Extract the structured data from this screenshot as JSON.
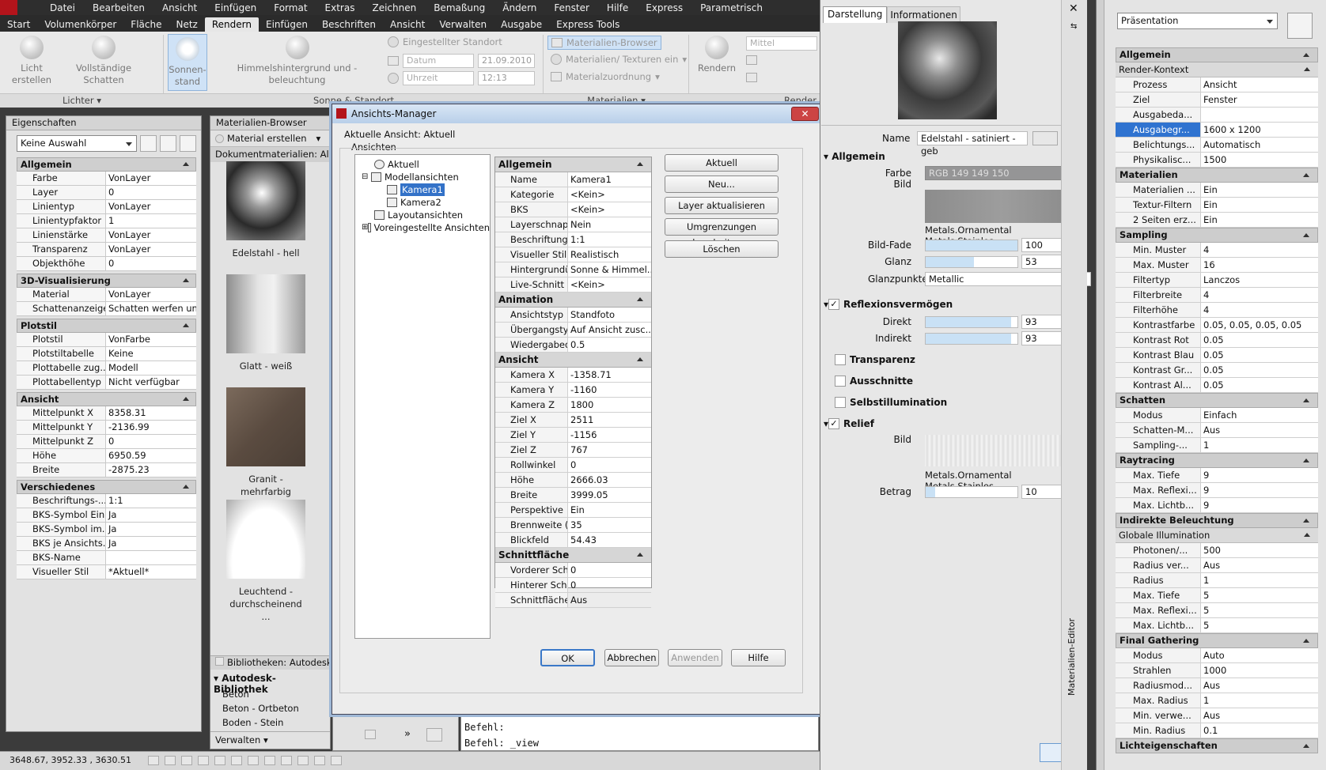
{
  "menubar": {
    "items": [
      "Datei",
      "Bearbeiten",
      "Ansicht",
      "Einfügen",
      "Format",
      "Extras",
      "Zeichnen",
      "Bemaßung",
      "Ändern",
      "Fenster",
      "Hilfe",
      "Express",
      "Parametrisch"
    ]
  },
  "ribbon_tabs": {
    "items": [
      "Start",
      "Volumenkörper",
      "Fläche",
      "Netz",
      "Rendern",
      "Einfügen",
      "Beschriften",
      "Ansicht",
      "Verwalten",
      "Ausgabe",
      "Express Tools"
    ],
    "active": "Rendern"
  },
  "ribbon": {
    "licht_erstellen": "Licht erstellen",
    "schatten": "Vollständige Schatten",
    "sonnenstand": "Sonnen-stand",
    "himmel": "Himmelshintergrund und -beleuchtung",
    "standort": "Eingestellter Standort",
    "datum_label": "Datum",
    "datum_value": "21.09.2010",
    "uhrzeit_label": "Uhrzeit",
    "uhrzeit_value": "12:13",
    "mat_browser": "Materialien-Browser",
    "mat_texturen": "Materialien/ Texturen ein",
    "mat_zuordnung": "Materialzuordnung",
    "rendern": "Rendern",
    "qualitaet": "Mittel",
    "group_lichter": "Lichter",
    "group_sonne": "Sonne & Standort",
    "group_materialien": "Materialien",
    "group_render": "Render"
  },
  "properties": {
    "title": "Eigenschaften",
    "selection": "Keine Auswahl",
    "categories": [
      {
        "name": "Allgemein",
        "rows": [
          [
            "Farbe",
            "VonLayer"
          ],
          [
            "Layer",
            "0"
          ],
          [
            "Linientyp",
            "VonLayer"
          ],
          [
            "Linientypfaktor",
            "1"
          ],
          [
            "Linienstärke",
            "VonLayer"
          ],
          [
            "Transparenz",
            "VonLayer"
          ],
          [
            "Objekthöhe",
            "0"
          ]
        ]
      },
      {
        "name": "3D-Visualisierung",
        "rows": [
          [
            "Material",
            "VonLayer"
          ],
          [
            "Schattenanzeige",
            "Schatten werfen un..."
          ]
        ]
      },
      {
        "name": "Plotstil",
        "rows": [
          [
            "Plotstil",
            "VonFarbe"
          ],
          [
            "Plotstiltabelle",
            "Keine"
          ],
          [
            "Plottabelle zug...",
            "Modell"
          ],
          [
            "Plottabellentyp",
            "Nicht verfügbar"
          ]
        ]
      },
      {
        "name": "Ansicht",
        "rows": [
          [
            "Mittelpunkt X",
            "8358.31"
          ],
          [
            "Mittelpunkt Y",
            "-2136.99"
          ],
          [
            "Mittelpunkt Z",
            "0"
          ],
          [
            "Höhe",
            "6950.59"
          ],
          [
            "Breite",
            "-2875.23"
          ]
        ]
      },
      {
        "name": "Verschiedenes",
        "rows": [
          [
            "Beschriftungs-...",
            "1:1"
          ],
          [
            "BKS-Symbol Ein",
            "Ja"
          ],
          [
            "BKS-Symbol im...",
            "Ja"
          ],
          [
            "BKS je Ansichts...",
            "Ja"
          ],
          [
            "BKS-Name",
            ""
          ],
          [
            "Visueller Stil",
            "*Aktuell*"
          ]
        ]
      }
    ]
  },
  "materials": {
    "title": "Materialien-Browser",
    "create": "Material erstellen",
    "doc_label": "Dokumentmaterialien: Alle",
    "items": [
      "Edelstahl - hell",
      "Glatt - weiß",
      "Granit - mehrfarbig",
      "Leuchtend - durchscheinend ..."
    ],
    "library_header": "Bibliotheken: Autodesk-",
    "library_name": "Autodesk-Bibliothek",
    "library_items": [
      "Beton",
      "Beton - Ortbeton",
      "Boden - Stein"
    ],
    "manage": "Verwalten"
  },
  "command": {
    "line1": "Befehl:",
    "line2": "Befehl: _view"
  },
  "status": {
    "coords": "3648.67, 3952.33 , 3630.51"
  },
  "dialog": {
    "title": "Ansichts-Manager",
    "current": "Aktuelle Ansicht: Aktuell",
    "views_label": "Ansichten",
    "tree": [
      "Aktuell",
      "Modellansichten",
      "Kamera1",
      "Kamera2",
      "Layoutansichten",
      "Voreingestellte Ansichten"
    ],
    "groups": [
      {
        "name": "Allgemein",
        "rows": [
          [
            "Name",
            "Kamera1"
          ],
          [
            "Kategorie",
            "<Kein>"
          ],
          [
            "BKS",
            "<Kein>"
          ],
          [
            "Layerschnapps...",
            "Nein"
          ],
          [
            "Beschriftungs-...",
            "1:1"
          ],
          [
            "Visueller Stil",
            "Realistisch"
          ],
          [
            "Hintergrundü...",
            "Sonne & Himmel..."
          ],
          [
            "Live-Schnitt",
            "<Kein>"
          ]
        ]
      },
      {
        "name": "Animation",
        "rows": [
          [
            "Ansichtstyp",
            "Standfoto"
          ],
          [
            "Übergangstyp",
            "Auf Ansicht zusc..."
          ],
          [
            "Wiedergabeda...",
            "0.5"
          ]
        ]
      },
      {
        "name": "Ansicht",
        "rows": [
          [
            "Kamera X",
            "-1358.71"
          ],
          [
            "Kamera Y",
            "-1160"
          ],
          [
            "Kamera Z",
            "1800"
          ],
          [
            "Ziel X",
            "2511"
          ],
          [
            "Ziel Y",
            "-1156"
          ],
          [
            "Ziel Z",
            "767"
          ],
          [
            "Rollwinkel",
            "0"
          ],
          [
            "Höhe",
            "2666.03"
          ],
          [
            "Breite",
            "3999.05"
          ],
          [
            "Perspektive",
            "Ein"
          ],
          [
            "Brennweite (m...",
            "35"
          ],
          [
            "Blickfeld",
            "54.43"
          ]
        ]
      },
      {
        "name": "Schnittfläche",
        "rows": [
          [
            "Vorderer Schnitt",
            "0"
          ],
          [
            "Hinterer Schnitt",
            "0"
          ],
          [
            "Schnittfläche",
            "Aus"
          ]
        ]
      }
    ],
    "buttons": [
      "Aktuell",
      "Neu...",
      "Layer aktualisieren",
      "Umgrenzungen bearbeiten...",
      "Löschen"
    ],
    "ok": "OK",
    "cancel": "Abbrechen",
    "apply": "Anwenden",
    "help": "Hilfe"
  },
  "editor": {
    "tab1": "Darstellung",
    "tab2": "Informationen",
    "name_label": "Name",
    "name_value": "Edelstahl - satiniert - geb",
    "allgemein": "Allgemein",
    "farbe_label": "Farbe",
    "farbe_value": "RGB 149 149 150",
    "bild_label": "Bild",
    "bild_path": "Metals.Ornamental Metals.Stainles...",
    "bildfade_label": "Bild-Fade",
    "bildfade_value": "100",
    "glanz_label": "Glanz",
    "glanz_value": "53",
    "glanzpunkte_label": "Glanzpunkte",
    "glanzpunkte_value": "Metallic",
    "reflexion": "Reflexionsvermögen",
    "direkt_label": "Direkt",
    "direkt_value": "93",
    "indirekt_label": "Indirekt",
    "indirekt_value": "93",
    "transparenz": "Transparenz",
    "ausschnitte": "Ausschnitte",
    "selbst": "Selbstillumination",
    "relief": "Relief",
    "relief_bild_label": "Bild",
    "relief_path": "Metals.Ornamental Metals.Stainles...",
    "betrag_label": "Betrag",
    "betrag_value": "10",
    "side_label": "Materialien-Editor"
  },
  "render": {
    "preset": "Präsentation",
    "sections": [
      {
        "name": "Allgemein",
        "sub": "Render-Kontext",
        "rows": [
          [
            "Prozess",
            "Ansicht"
          ],
          [
            "Ziel",
            "Fenster"
          ],
          [
            "Ausgabeda...",
            ""
          ],
          [
            "Ausgabegr...",
            "1600 x 1200"
          ],
          [
            "Belichtungs...",
            "Automatisch"
          ],
          [
            "Physikalisc...",
            "1500"
          ]
        ]
      },
      {
        "name": "Materialien",
        "rows": [
          [
            "Materialien ...",
            "Ein"
          ],
          [
            "Textur-Filtern",
            "Ein"
          ],
          [
            "2 Seiten erz...",
            "Ein"
          ]
        ]
      },
      {
        "name": "Sampling",
        "rows": [
          [
            "Min. Muster",
            "4"
          ],
          [
            "Max. Muster",
            "16"
          ],
          [
            "Filtertyp",
            "Lanczos"
          ],
          [
            "Filterbreite",
            "4"
          ],
          [
            "Filterhöhe",
            "4"
          ],
          [
            "Kontrastfarbe",
            "0.05, 0.05, 0.05, 0.05"
          ],
          [
            "Kontrast Rot",
            "0.05"
          ],
          [
            "Kontrast Blau",
            "0.05"
          ],
          [
            "Kontrast Gr...",
            "0.05"
          ],
          [
            "Kontrast Al...",
            "0.05"
          ]
        ]
      },
      {
        "name": "Schatten",
        "rows": [
          [
            "Modus",
            "Einfach"
          ],
          [
            "Schatten-M...",
            "Aus"
          ],
          [
            "Sampling-...",
            "1"
          ]
        ]
      },
      {
        "name": "Raytracing",
        "rows": [
          [
            "Max. Tiefe",
            "9"
          ],
          [
            "Max. Reflexi...",
            "9"
          ],
          [
            "Max. Lichtb...",
            "9"
          ]
        ]
      },
      {
        "name": "Indirekte Beleuchtung",
        "sub": "Globale Illumination",
        "rows": [
          [
            "Photonen/...",
            "500"
          ],
          [
            "Radius ver...",
            "Aus"
          ],
          [
            "Radius",
            "1"
          ],
          [
            "Max. Tiefe",
            "5"
          ],
          [
            "Max. Reflexi...",
            "5"
          ],
          [
            "Max. Lichtb...",
            "5"
          ]
        ]
      },
      {
        "name": "Final Gathering",
        "rows": [
          [
            "Modus",
            "Auto"
          ],
          [
            "Strahlen",
            "1000"
          ],
          [
            "Radiusmod...",
            "Aus"
          ],
          [
            "Max. Radius",
            "1"
          ],
          [
            "Min. verwe...",
            "Aus"
          ],
          [
            "Min. Radius",
            "0.1"
          ]
        ]
      },
      {
        "name": "Lichteigenschaften",
        "rows": []
      }
    ]
  }
}
